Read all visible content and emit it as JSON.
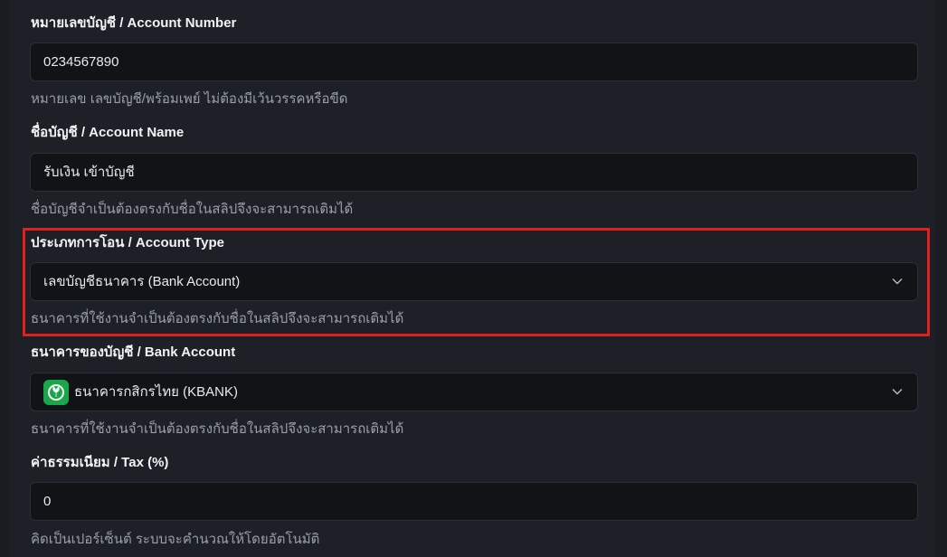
{
  "account_number": {
    "label": "หมายเลขบัญชี / Account Number",
    "value": "0234567890",
    "help": "หมายเลข เลขบัญชี/พร้อมเพย์ ไม่ต้องมีเว้นวรรคหรือขีด"
  },
  "account_name": {
    "label": "ชื่อบัญชี / Account Name",
    "value": "รับเงิน เข้าบัญชี",
    "help": "ชื่อบัญชีจำเป็นต้องตรงกับชื่อในสลิปจึงจะสามารถเติมได้"
  },
  "account_type": {
    "label": "ประเภทการโอน / Account Type",
    "selected": "เลขบัญชีธนาคาร (Bank Account)",
    "help": "ธนาคารที่ใช้งานจำเป็นต้องตรงกับชื่อในสลิปจึงจะสามารถเติมได้",
    "highlight_color": "#e0201f"
  },
  "bank_account": {
    "label": "ธนาคารของบัญชี / Bank Account",
    "selected": "ธนาคารกสิกรไทย (KBANK)",
    "logo_icon": "kbank-logo-icon",
    "logo_color": "#1aa64a",
    "help": "ธนาคารที่ใช้งานจำเป็นต้องตรงกับชื่อในสลิปจึงจะสามารถเติมได้"
  },
  "tax": {
    "label": "ค่าธรรมเนียม / Tax (%)",
    "value": "0",
    "help": "คิดเป็นเปอร์เซ็นต์ ระบบจะคำนวณให้โดยอัตโนมัติ"
  }
}
